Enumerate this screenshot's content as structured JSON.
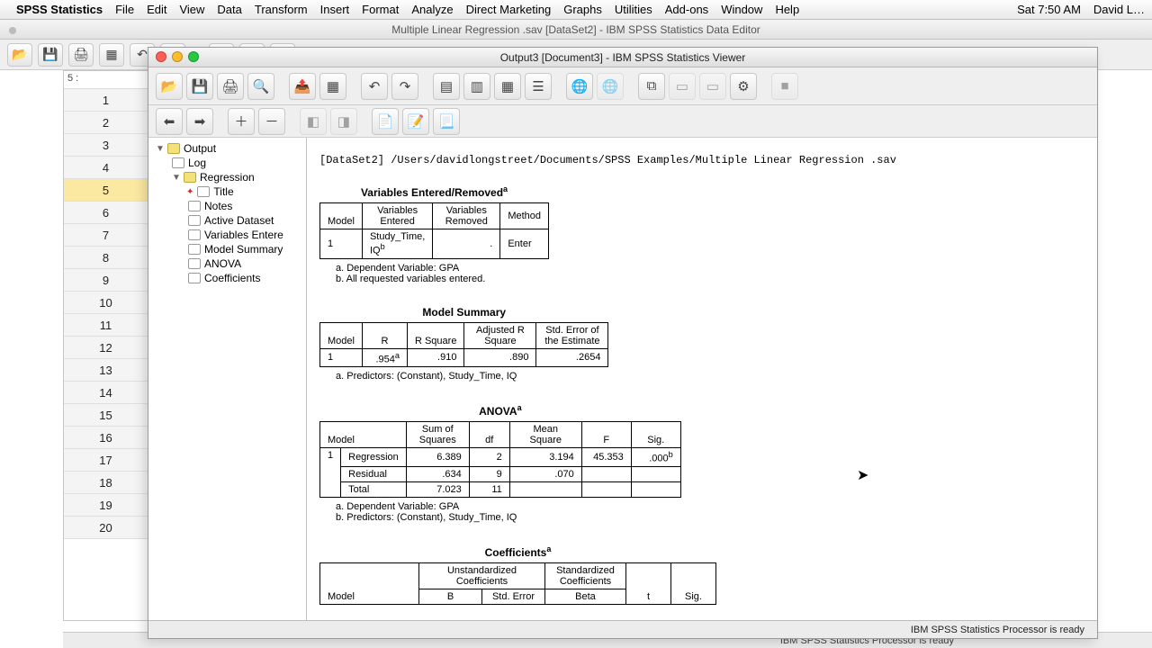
{
  "menubar": {
    "app": "SPSS Statistics",
    "items": [
      "File",
      "Edit",
      "View",
      "Data",
      "Transform",
      "Insert",
      "Format",
      "Analyze",
      "Direct Marketing",
      "Graphs",
      "Utilities",
      "Add-ons",
      "Window",
      "Help"
    ],
    "clock": "Sat 7:50 AM",
    "user": "David L…"
  },
  "bgwin": {
    "title": "Multiple Linear Regression .sav [DataSet2] - IBM SPSS Statistics Data Editor",
    "cell5label": "5 :",
    "rows": [
      "1",
      "2",
      "3",
      "4",
      "5",
      "6",
      "7",
      "8",
      "9",
      "10",
      "11",
      "12",
      "13",
      "14",
      "15",
      "16",
      "17",
      "18",
      "19",
      "20"
    ],
    "status": "IBM SPSS Statistics Processor is ready"
  },
  "viewer": {
    "title": "Output3 [Document3] - IBM SPSS Statistics Viewer",
    "status": "IBM SPSS Statistics Processor is ready"
  },
  "outline": {
    "root": "Output",
    "log": "Log",
    "reg": "Regression",
    "items": [
      "Title",
      "Notes",
      "Active Dataset",
      "Variables Entere",
      "Model Summary",
      "ANOVA",
      "Coefficients"
    ]
  },
  "content": {
    "dataset": "[DataSet2] /Users/davidlongstreet/Documents/SPSS Examples/Multiple Linear Regression .sav",
    "t1": {
      "title": "Variables Entered/Removed",
      "h": [
        "Model",
        "Variables Entered",
        "Variables Removed",
        "Method"
      ],
      "row": [
        "1",
        "Study_Time, IQ",
        ". ",
        "Enter"
      ],
      "fa": "a. Dependent Variable: GPA",
      "fb": "b. All requested variables entered."
    },
    "t2": {
      "title": "Model Summary",
      "h": [
        "Model",
        "R",
        "R Square",
        "Adjusted R Square",
        "Std. Error of the Estimate"
      ],
      "row": [
        "1",
        ".954",
        ".910",
        ".890",
        ".2654"
      ],
      "fa": "a. Predictors: (Constant), Study_Time, IQ"
    },
    "t3": {
      "title": "ANOVA",
      "h": [
        "Model",
        "",
        "Sum of Squares",
        "df",
        "Mean Square",
        "F",
        "Sig."
      ],
      "rows": [
        [
          "1",
          "Regression",
          "6.389",
          "2",
          "3.194",
          "45.353",
          ".000"
        ],
        [
          "",
          "Residual",
          ".634",
          "9",
          ".070",
          "",
          ""
        ],
        [
          "",
          "Total",
          "7.023",
          "11",
          "",
          "",
          ""
        ]
      ],
      "fa": "a. Dependent Variable: GPA",
      "fb": "b. Predictors: (Constant), Study_Time, IQ"
    },
    "t4": {
      "title": "Coefficients",
      "g1": "Unstandardized Coefficients",
      "g2": "Standardized Coefficients",
      "h": [
        "Model",
        "B",
        "Std. Error",
        "Beta",
        "t",
        "Sig."
      ]
    }
  }
}
